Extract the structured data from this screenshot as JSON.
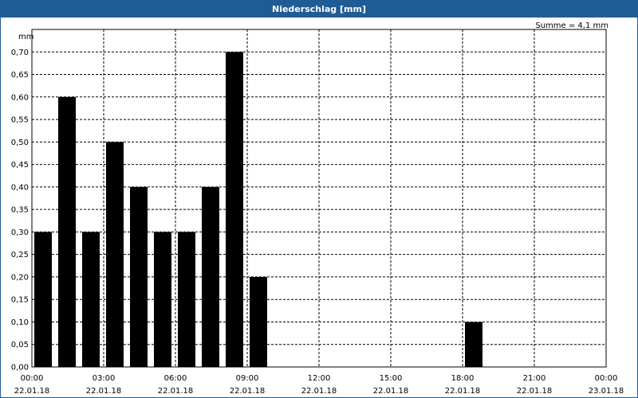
{
  "window": {
    "title": "Niederschlag [mm]"
  },
  "summary": {
    "text": "Summe = 4,1 mm"
  },
  "chart_data": {
    "type": "bar",
    "title": "Niederschlag [mm]",
    "ylabel": "mm",
    "ylim": [
      0,
      0.75
    ],
    "y_ticks": [
      "0,00",
      "0,05",
      "0,10",
      "0,15",
      "0,20",
      "0,25",
      "0,30",
      "0,35",
      "0,40",
      "0,45",
      "0,50",
      "0,55",
      "0,60",
      "0,65",
      "0,70"
    ],
    "x_ticks": [
      {
        "time": "00:00",
        "date": "22.01.18"
      },
      {
        "time": "03:00",
        "date": "22.01.18"
      },
      {
        "time": "06:00",
        "date": "22.01.18"
      },
      {
        "time": "09:00",
        "date": "22.01.18"
      },
      {
        "time": "12:00",
        "date": "22.01.18"
      },
      {
        "time": "15:00",
        "date": "22.01.18"
      },
      {
        "time": "18:00",
        "date": "22.01.18"
      },
      {
        "time": "21:00",
        "date": "22.01.18"
      },
      {
        "time": "00:00",
        "date": "23.01.18"
      }
    ],
    "bars": [
      {
        "start": "22.01.18 00:00",
        "value": 0.3
      },
      {
        "start": "22.01.18 01:00",
        "value": 0.6
      },
      {
        "start": "22.01.18 02:00",
        "value": 0.3
      },
      {
        "start": "22.01.18 03:00",
        "value": 0.5
      },
      {
        "start": "22.01.18 04:00",
        "value": 0.4
      },
      {
        "start": "22.01.18 05:00",
        "value": 0.3
      },
      {
        "start": "22.01.18 06:00",
        "value": 0.3
      },
      {
        "start": "22.01.18 07:00",
        "value": 0.4
      },
      {
        "start": "22.01.18 08:00",
        "value": 0.7
      },
      {
        "start": "22.01.18 09:00",
        "value": 0.2
      },
      {
        "start": "22.01.18 18:00",
        "value": 0.1
      }
    ],
    "grid": true,
    "bar_color": "#000000"
  }
}
